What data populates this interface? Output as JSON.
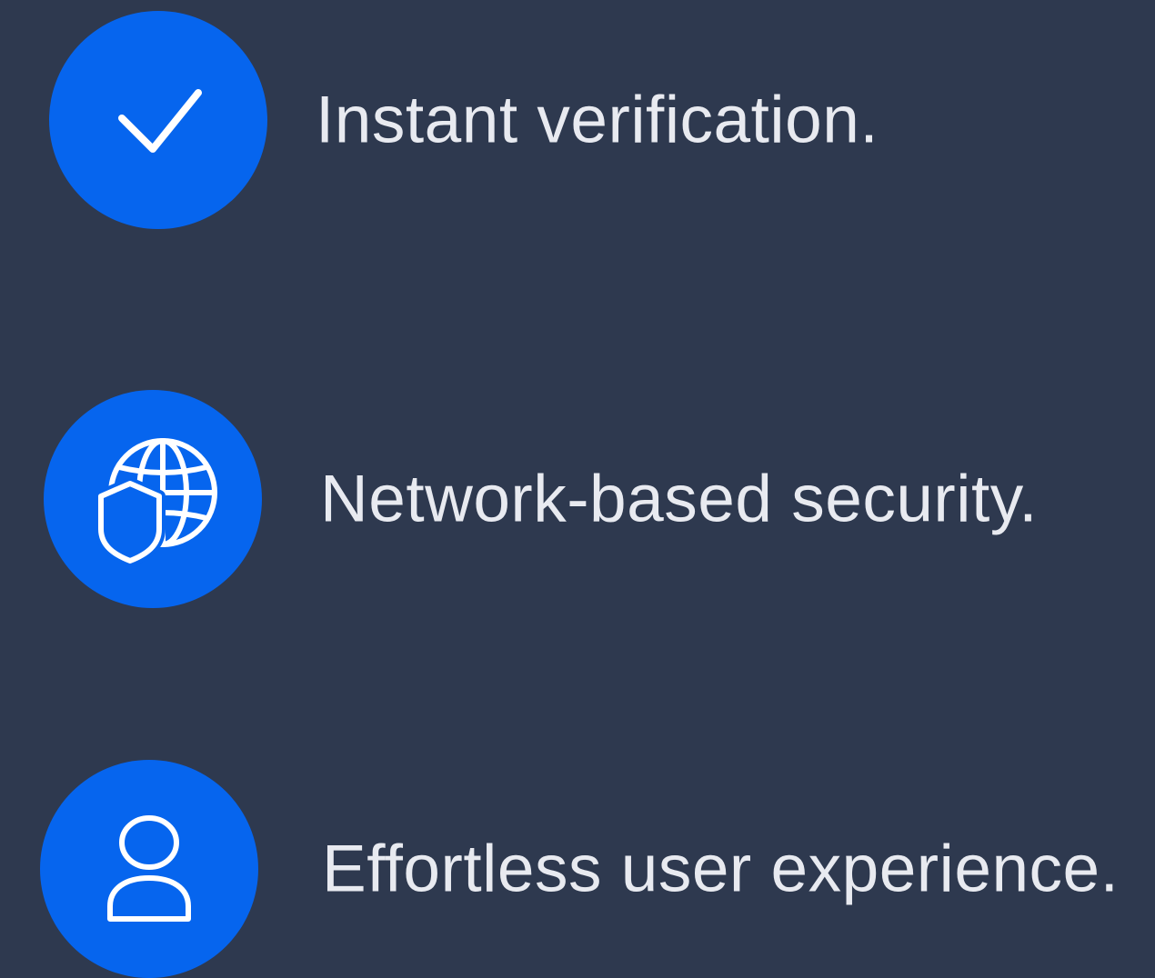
{
  "features": [
    {
      "label": "Instant verification.",
      "icon": "checkmark-icon"
    },
    {
      "label": "Network-based security.",
      "icon": "globe-shield-icon"
    },
    {
      "label": "Effortless user experience.",
      "icon": "user-icon"
    }
  ],
  "colors": {
    "background": "#2e394f",
    "badge": "#0665ee",
    "text": "#e8eaf0",
    "icon_stroke": "#ffffff"
  }
}
